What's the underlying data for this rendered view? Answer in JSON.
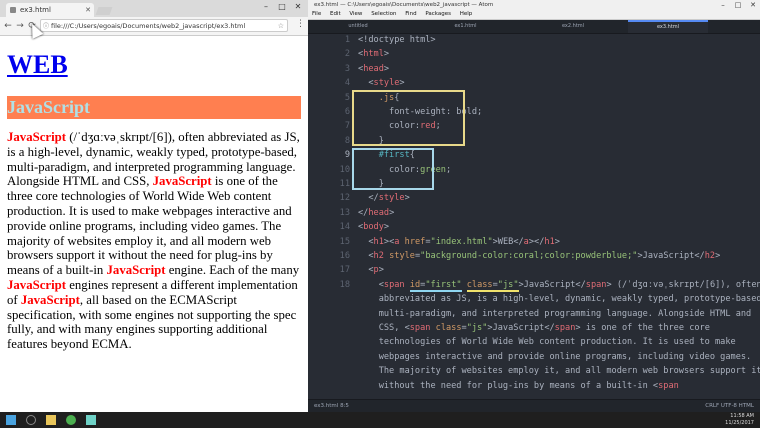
{
  "chrome": {
    "tab_title": "ex3.html",
    "url": "file:///C:/Users/egoais/Documents/web2_javascript/ex3.html",
    "nav": {
      "back": "←",
      "forward": "→",
      "reload": "⟳"
    }
  },
  "page": {
    "h1": "WEB",
    "h2": "JavaScript",
    "p_parts": {
      "js1": "JavaScript",
      "t1": " (/ˈdʒɑːvəˌskrɪpt/[6]), often abbreviated as JS, is a high-level, dynamic, weakly typed, prototype-based, multi-paradigm, and interpreted programming language. Alongside HTML and CSS, ",
      "js2": "JavaScript",
      "t2": " is one of the three core technologies of World Wide Web content production. It is used to make webpages interactive and provide online programs, including video games. The majority of websites employ it, and all modern web browsers support it without the need for plug-ins by means of a built-in ",
      "js3": "JavaScript",
      "t3": " engine. Each of the many ",
      "js4": "JavaScript",
      "t4": " engines represent a different implementation of ",
      "js5": "JavaScript",
      "t5": ", all based on the ECMAScript specification, with some engines not supporting the spec fully, and with many engines supporting additional features beyond ECMA."
    }
  },
  "atom": {
    "title": "ex3.html — C:\\Users\\egoais\\Documents\\web2_javascript — Atom",
    "menu": [
      "File",
      "Edit",
      "View",
      "Selection",
      "Find",
      "Packages",
      "Help"
    ],
    "tabs": [
      "untitled",
      "ex1.html",
      "ex2.html",
      "ex3.html"
    ],
    "line_numbers": [
      "1",
      "2",
      "3",
      "4",
      "5",
      "6",
      "7",
      "8",
      "9",
      "10",
      "11",
      "12",
      "13",
      "14",
      "15",
      "16",
      "17",
      "18"
    ],
    "status_left": "ex3.html   8:5",
    "status_right": "CRLF  UTF-8  HTML"
  },
  "taskbar": {
    "time": "11:58 AM",
    "date": "11/25/2017"
  },
  "colors": {
    "h2_bg": "#ff7f50",
    "h2_fg": "#b0e0e6",
    "js_red": "#ff0000",
    "highlight_yellow": "#e8d98a",
    "highlight_blue": "#a8d8ea"
  }
}
